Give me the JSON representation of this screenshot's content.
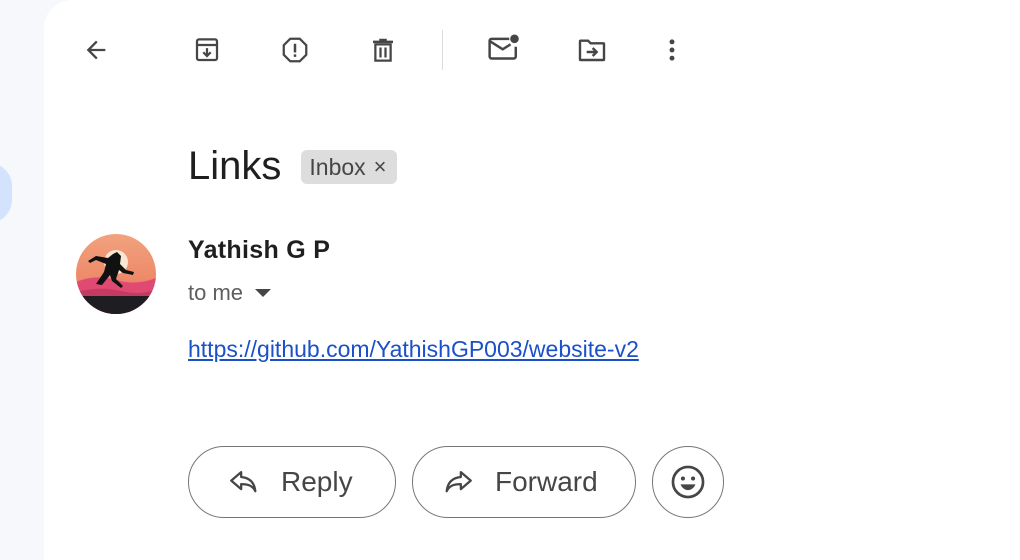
{
  "toolbar": {
    "back_icon": "arrow-left-icon",
    "archive_icon": "archive-icon",
    "spam_icon": "report-spam-icon",
    "delete_icon": "trash-icon",
    "mark_unread_icon": "mark-unread-icon",
    "move_icon": "move-to-folder-icon",
    "more_icon": "more-vert-icon"
  },
  "email": {
    "subject": "Links",
    "label": "Inbox",
    "label_remove": "×",
    "sender_name": "Yathish G P",
    "recipient": "to me",
    "body_link": "https://github.com/YathishGP003/website-v2"
  },
  "actions": {
    "reply_label": "Reply",
    "forward_label": "Forward",
    "emoji_icon": "smiley-icon"
  },
  "colors": {
    "link": "#1a50c8",
    "chip_bg": "#dddddd",
    "nav_accent": "#d3e3fd"
  }
}
